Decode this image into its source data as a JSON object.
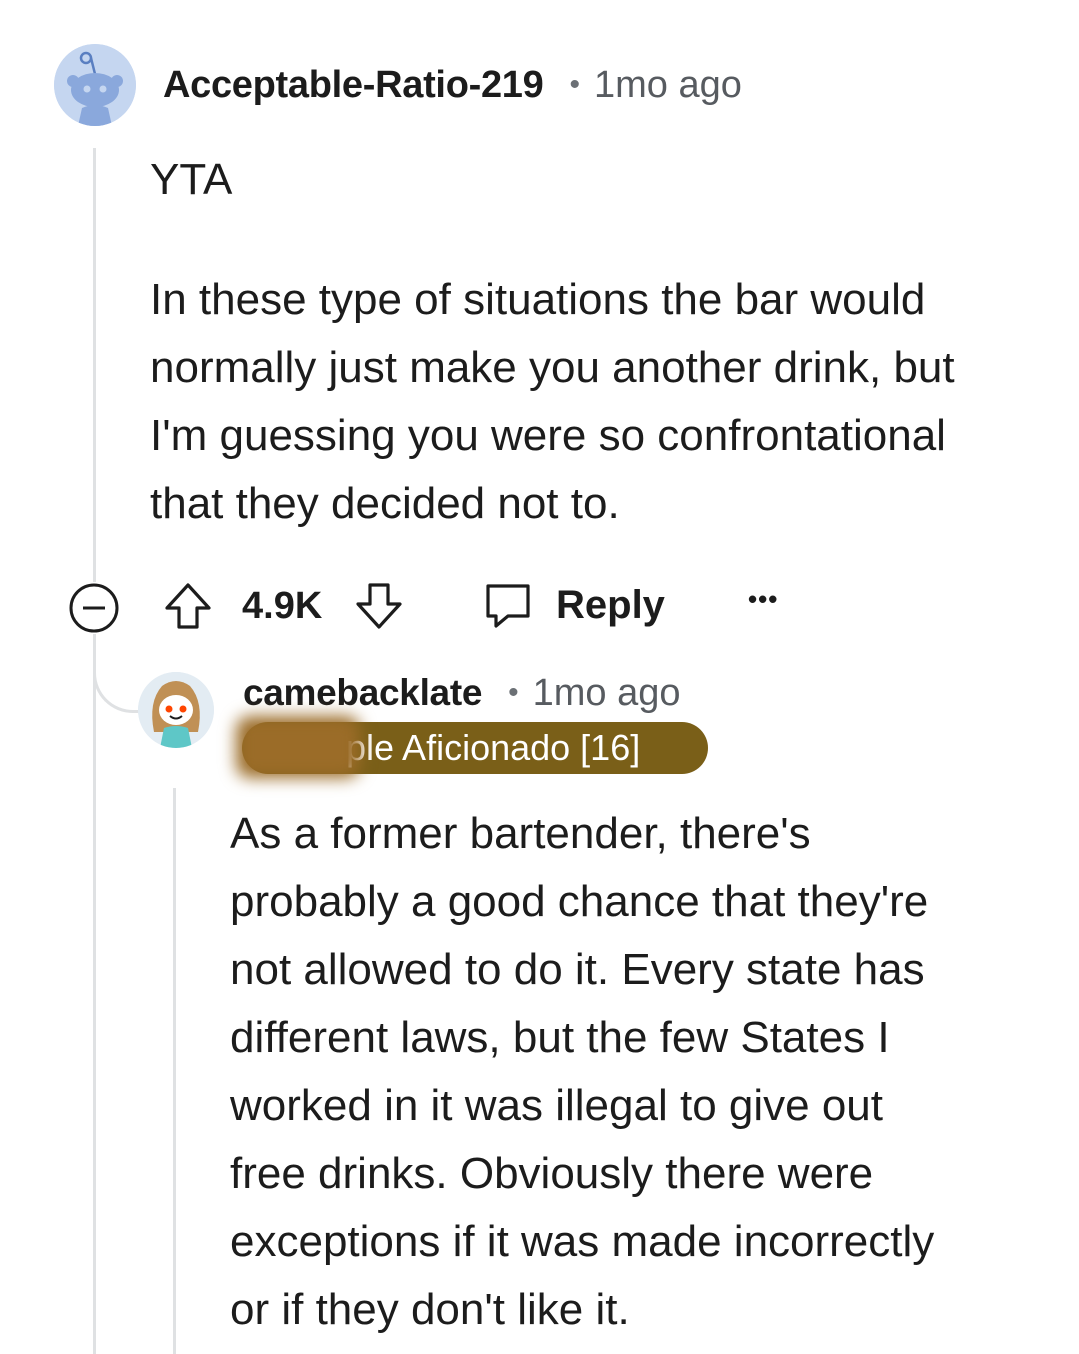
{
  "comment": {
    "username": "Acceptable-Ratio-219",
    "separator": "•",
    "time": "1mo ago",
    "paragraphs": [
      [
        "YTA"
      ],
      [
        "In these type of situations the bar would",
        "normally just make you another drink, but",
        "I'm guessing you were so confrontational",
        "that they decided not to."
      ]
    ],
    "actions": {
      "vote_count": "4.9K",
      "reply_label": "Reply",
      "more_label": "•••"
    }
  },
  "reply": {
    "username": "camebacklate",
    "separator": "•",
    "time": "1mo ago",
    "flair": "ple Aficionado [16]",
    "lines": [
      "As a former bartender, there's",
      "probably a good chance that they're",
      "not allowed to do it. Every state has",
      "different laws, but the few States I",
      "worked in it was illegal to give out",
      "free drinks. Obviously there were",
      "exceptions if it was made incorrectly",
      "or if they don't like it."
    ]
  },
  "colors": {
    "flair_bg": "#7a5f18",
    "thread_line": "#dfe1e3",
    "avatar_bg": "#c5d6f0"
  }
}
